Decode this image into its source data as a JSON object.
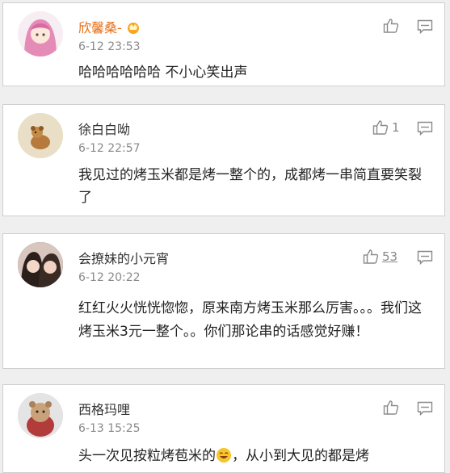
{
  "comments": [
    {
      "username": "欣馨桑-",
      "time": "6-12 23:53",
      "text": "哈哈哈哈哈哈 不小心笑出声",
      "likes": ""
    },
    {
      "username": "徐白白呦",
      "time": "6-12 22:57",
      "text": "我见过的烤玉米都是烤一整个的，成都烤一串简直要笑裂了",
      "likes": "1"
    },
    {
      "username": "会撩妹的小元宵",
      "time": "6-12 20:22",
      "text": "红红火火恍恍惚惚，原来南方烤玉米那么厉害。。。我们这烤玉米3元一整个。。你们那论串的话感觉好赚！",
      "likes": "53"
    },
    {
      "username": "西格玛哩",
      "time": "6-13 15:25",
      "text_before_emoji": "头一次见按粒烤苞米的",
      "text_after_emoji": "，从小到大见的都是烤",
      "likes": ""
    }
  ]
}
